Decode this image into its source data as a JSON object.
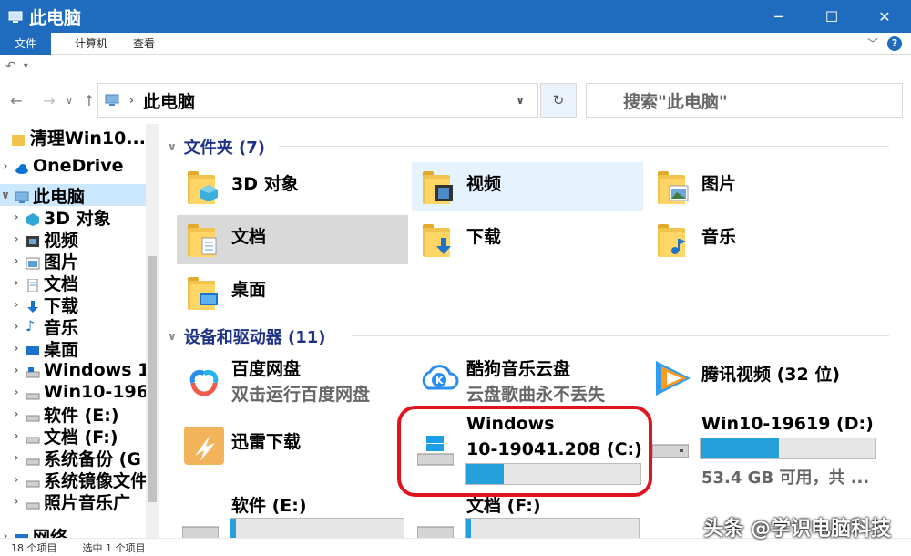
{
  "window": {
    "title": "此电脑"
  },
  "ribbon": {
    "tabs": [
      "文件",
      "计算机",
      "查看"
    ]
  },
  "address": {
    "path": "此电脑",
    "search_placeholder": "搜索\"此电脑\""
  },
  "nav": {
    "items": [
      {
        "label": "清理Win10...",
        "icon": "folder-icon"
      },
      {
        "label": "OneDrive",
        "icon": "cloud-icon"
      },
      {
        "label": "此电脑",
        "icon": "computer-icon"
      },
      {
        "label": "3D 对象",
        "icon": "cube-icon"
      },
      {
        "label": "视频",
        "icon": "video-icon"
      },
      {
        "label": "图片",
        "icon": "picture-icon"
      },
      {
        "label": "文档",
        "icon": "document-icon"
      },
      {
        "label": "下载",
        "icon": "download-icon"
      },
      {
        "label": "音乐",
        "icon": "music-icon"
      },
      {
        "label": "桌面",
        "icon": "desktop-icon"
      },
      {
        "label": "Windows 1",
        "icon": "drive-icon"
      },
      {
        "label": "Win10-196",
        "icon": "drive-icon"
      },
      {
        "label": "软件 (E:)",
        "icon": "drive-icon"
      },
      {
        "label": "文档 (F:)",
        "icon": "drive-icon"
      },
      {
        "label": "系统备份 (G",
        "icon": "drive-icon"
      },
      {
        "label": "系统镜像文件",
        "icon": "drive-icon"
      },
      {
        "label": "照片音乐广",
        "icon": "drive-icon"
      },
      {
        "label": "网络",
        "icon": "network-icon"
      }
    ]
  },
  "groups": {
    "folders": {
      "title": "文件夹 (7)",
      "items": [
        "3D 对象",
        "视频",
        "图片",
        "文档",
        "下载",
        "音乐",
        "桌面"
      ]
    },
    "devices": {
      "title": "设备和驱动器 (11)",
      "items": [
        {
          "name": "百度网盘",
          "sub": "双击运行百度网盘"
        },
        {
          "name": "酷狗音乐云盘",
          "sub": "云盘歌曲永不丢失"
        },
        {
          "name": "腾讯视频 (32 位)",
          "sub": ""
        },
        {
          "name": "迅雷下载",
          "sub": ""
        },
        {
          "name": "Windows 10-19041.208 (C:)",
          "line1": "Windows",
          "line2": "10-19041.208 (C:)",
          "usage": 0.22
        },
        {
          "name": "Win10-19619 (D:)",
          "free": "53.4 GB 可用，共 ...",
          "usage": 0.45
        },
        {
          "name": "软件 (E:)",
          "usage": 0.03
        },
        {
          "name": "文档 (F:)",
          "usage": 0.03
        }
      ]
    }
  },
  "status": {
    "count": "18 个项目",
    "selected": "选中 1 个项目"
  },
  "watermark": "头条 @学识电脑科技",
  "colors": {
    "accent": "#1f6cbf",
    "bar_fill": "#26a0da",
    "highlight": "#e0141e",
    "group_head": "#1e3287"
  }
}
